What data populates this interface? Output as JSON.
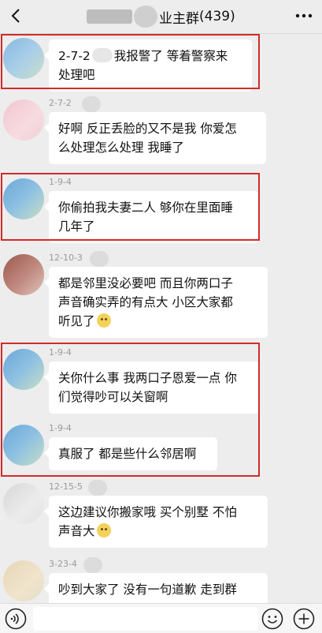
{
  "header": {
    "title_suffix": "业主群",
    "member_count": "(439)"
  },
  "messages": [
    {
      "sender": "",
      "text": "2-7-2 我报警了 等着警察来处理吧",
      "line1": "2-7-2",
      "line1b": "我报警了 等着警察来",
      "line2": "处理吧"
    },
    {
      "sender": "2-7-2",
      "line1": "好啊 反正丢脸的又不是我 你爱怎",
      "line2": "么处理怎么处理 我睡了"
    },
    {
      "sender": "1-9-4",
      "line1": "你偷拍我夫妻二人 够你在里面睡",
      "line2": "几年了"
    },
    {
      "sender": "12-10-3",
      "line1": "都是邻里没必要吧 而且你两口子",
      "line2": "声音确实弄的有点大 小区大家都",
      "line3": "听见了"
    },
    {
      "sender": "1-9-4",
      "line1": "关你什么事 我两口子恩爱一点 你",
      "line2": "们觉得吵可以关窗啊"
    },
    {
      "sender": "1-9-4",
      "line1": "真服了 都是些什么邻居啊"
    },
    {
      "sender": "12-15-5",
      "line1": "这边建议你搬家哦 买个别墅 不怕",
      "line2": "声音大"
    },
    {
      "sender": "3-23-4",
      "line1": "吵到大家了 没有一句道歉 走到群"
    }
  ],
  "colors": {
    "highlight": "#d12b2b",
    "bubble": "#ffffff",
    "background": "#ededed"
  }
}
